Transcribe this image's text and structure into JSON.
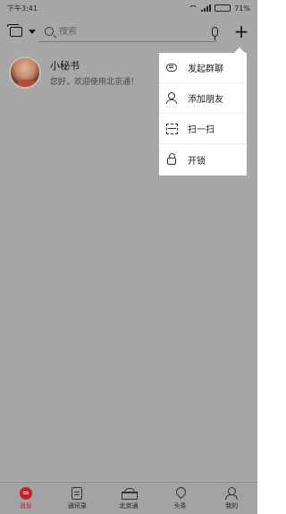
{
  "status_bar": {
    "time": "下午3:41",
    "battery": "71%",
    "battery_level": 0.71,
    "icons": [
      "wifi-icon",
      "signal-icon",
      "battery-icon"
    ]
  },
  "header": {
    "search_placeholder": "搜索",
    "icons": [
      "tablet-icon",
      "caret-down-icon",
      "search-icon",
      "mic-icon",
      "plus-icon"
    ]
  },
  "chat_list": [
    {
      "name": "小秘书",
      "message": "您好，欢迎使用北京通！"
    }
  ],
  "popup_menu": {
    "items": [
      {
        "label": "发起群聊",
        "icon": "group-chat-icon"
      },
      {
        "label": "添加朋友",
        "icon": "add-friend-icon"
      },
      {
        "label": "扫一扫",
        "icon": "scan-icon"
      },
      {
        "label": "开锁",
        "icon": "lock-icon"
      }
    ]
  },
  "tab_bar": {
    "accent": "#c0232c",
    "tabs": [
      {
        "label": "消息",
        "icon": "message-icon",
        "active": true
      },
      {
        "label": "通讯录",
        "icon": "contacts-icon",
        "active": false
      },
      {
        "label": "北京通",
        "icon": "beijing-icon",
        "active": false
      },
      {
        "label": "头条",
        "icon": "news-icon",
        "active": false
      },
      {
        "label": "我的",
        "icon": "profile-icon",
        "active": false
      }
    ]
  }
}
